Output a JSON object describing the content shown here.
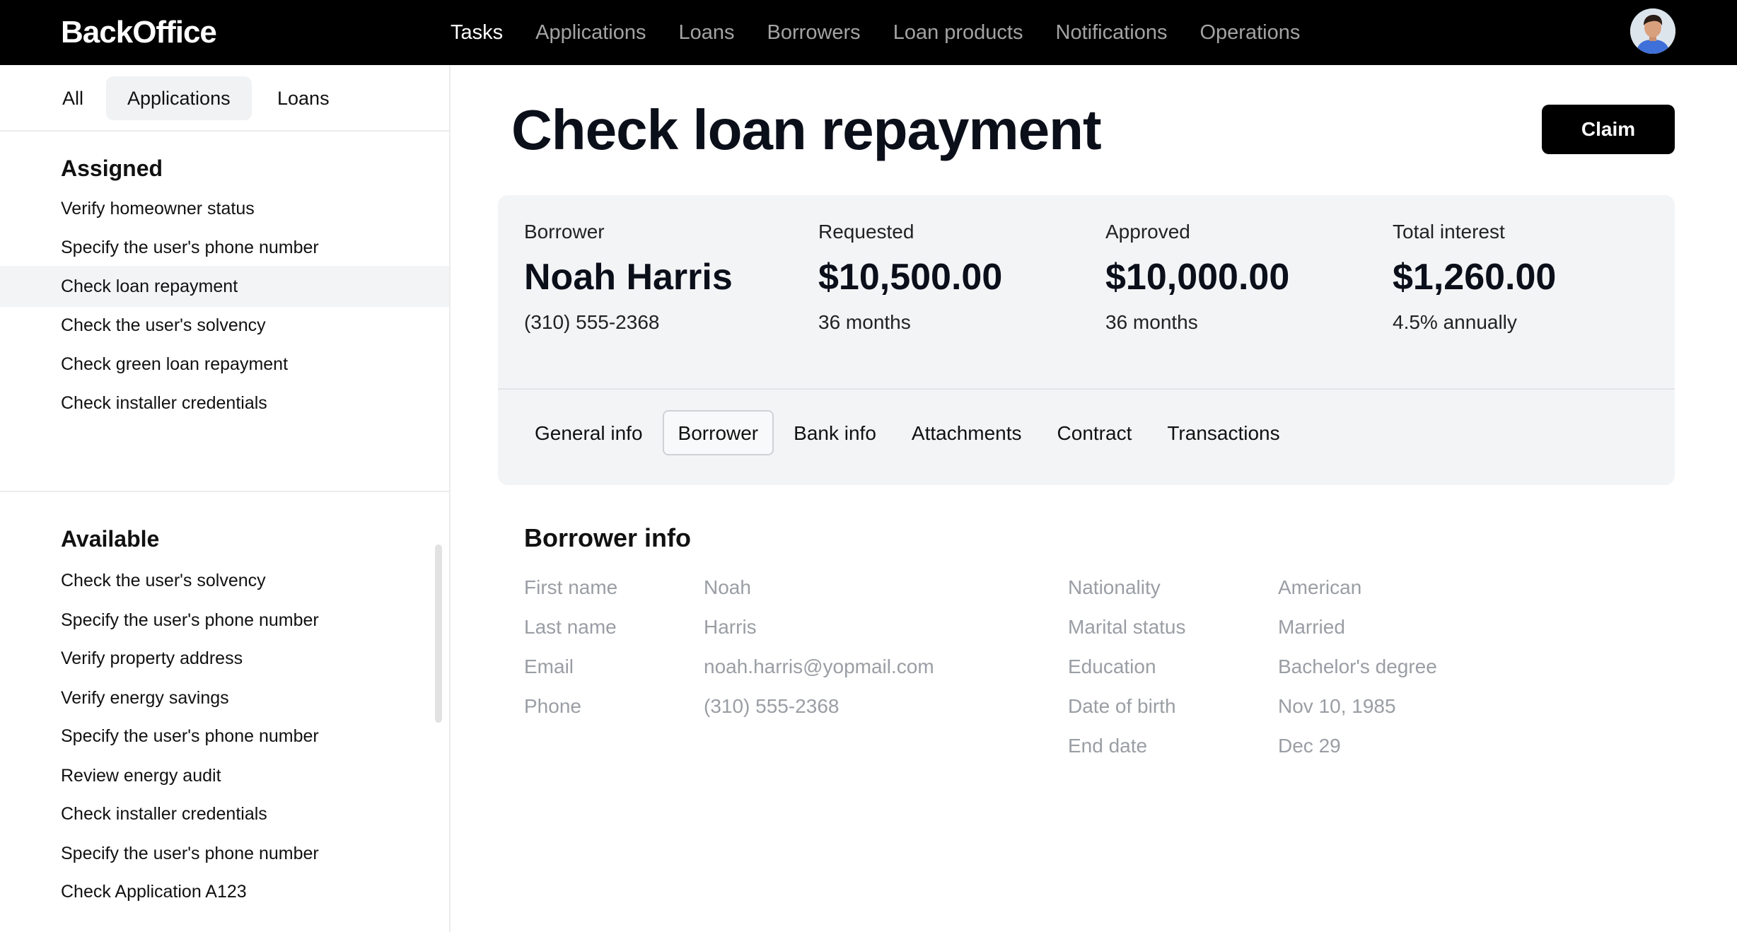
{
  "app": {
    "logo": "BackOffice"
  },
  "nav": {
    "items": [
      {
        "label": "Tasks",
        "active": true
      },
      {
        "label": "Applications",
        "active": false
      },
      {
        "label": "Loans",
        "active": false
      },
      {
        "label": "Borrowers",
        "active": false
      },
      {
        "label": "Loan products",
        "active": false
      },
      {
        "label": "Notifications",
        "active": false
      },
      {
        "label": "Operations",
        "active": false
      }
    ]
  },
  "sidebar": {
    "tabs": [
      {
        "label": "All"
      },
      {
        "label": "Applications",
        "active": true
      },
      {
        "label": "Loans"
      }
    ],
    "assigned": {
      "title": "Assigned",
      "items": [
        "Verify homeowner status",
        "Specify the user's phone number",
        "Check loan repayment",
        "Check the user's solvency",
        "Check green loan repayment",
        "Check installer credentials"
      ],
      "selected_index": 2
    },
    "available": {
      "title": "Available",
      "items": [
        "Check the user's solvency",
        "Specify the user's phone number",
        "Verify property address",
        "Verify energy savings",
        "Specify the user's phone number",
        "Review energy audit",
        "Check installer credentials",
        "Specify the user's phone number",
        "Check Application A123"
      ]
    }
  },
  "main": {
    "title": "Check loan repayment",
    "claim_label": "Claim",
    "summary": {
      "borrower": {
        "label": "Borrower",
        "value": "Noah Harris",
        "sub": "(310) 555-2368"
      },
      "requested": {
        "label": "Requested",
        "value": "$10,500.00",
        "sub": "36 months"
      },
      "approved": {
        "label": "Approved",
        "value": "$10,000.00",
        "sub": "36 months"
      },
      "interest": {
        "label": "Total interest",
        "value": "$1,260.00",
        "sub": "4.5% annually"
      }
    },
    "tabs": [
      {
        "label": "General info"
      },
      {
        "label": "Borrower",
        "active": true
      },
      {
        "label": "Bank info"
      },
      {
        "label": "Attachments"
      },
      {
        "label": "Contract"
      },
      {
        "label": "Transactions"
      }
    ],
    "borrower_info": {
      "title": "Borrower info",
      "left": [
        {
          "label": "First name",
          "value": "Noah"
        },
        {
          "label": "Last name",
          "value": "Harris"
        },
        {
          "label": "Email",
          "value": "noah.harris@yopmail.com"
        },
        {
          "label": "Phone",
          "value": "(310) 555-2368"
        }
      ],
      "right": [
        {
          "label": "Nationality",
          "value": "American"
        },
        {
          "label": "Marital status",
          "value": "Married"
        },
        {
          "label": "Education",
          "value": "Bachelor's degree"
        },
        {
          "label": "Date of birth",
          "value": "Nov 10, 1985"
        },
        {
          "label": "End date",
          "value": "Dec 29"
        }
      ]
    }
  },
  "colors": {
    "topbar": "#000000",
    "nav_inactive": "#a3a3a3",
    "card_bg": "#f3f4f6",
    "muted_text": "#9a9ea4"
  }
}
